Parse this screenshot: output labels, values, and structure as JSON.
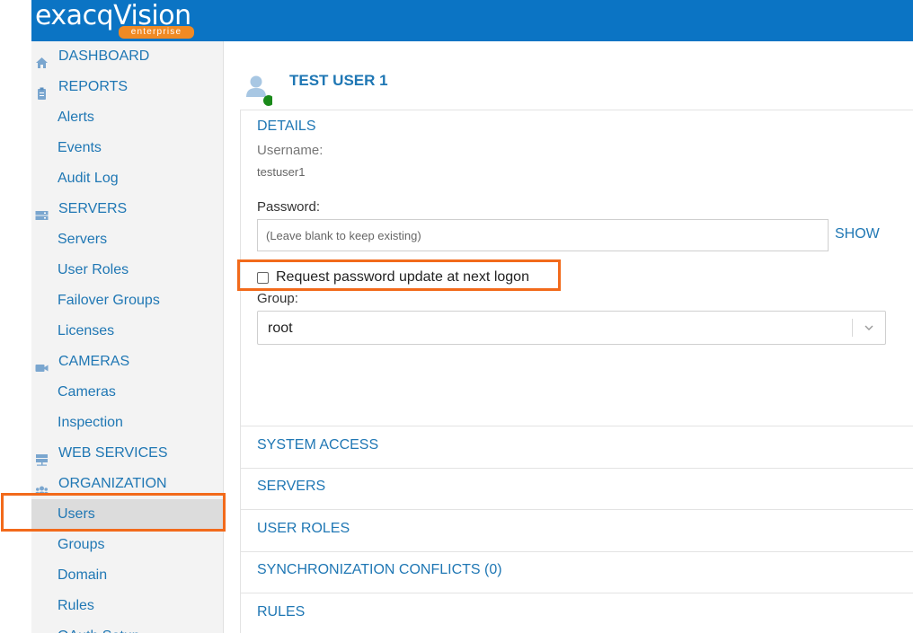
{
  "brand": {
    "logo_text": "exacqVision",
    "logo_sub": "enterprise",
    "header_color": "#0b74c4",
    "accent_color": "#f26a1b"
  },
  "sidebar": {
    "items": [
      {
        "label": "DASHBOARD",
        "kind": "top",
        "icon": "home-icon"
      },
      {
        "label": "REPORTS",
        "kind": "top",
        "icon": "clipboard-icon"
      },
      {
        "label": "Alerts",
        "kind": "sub"
      },
      {
        "label": "Events",
        "kind": "sub"
      },
      {
        "label": "Audit Log",
        "kind": "sub"
      },
      {
        "label": "SERVERS",
        "kind": "top",
        "icon": "server-icon"
      },
      {
        "label": "Servers",
        "kind": "sub"
      },
      {
        "label": "User Roles",
        "kind": "sub"
      },
      {
        "label": "Failover Groups",
        "kind": "sub"
      },
      {
        "label": "Licenses",
        "kind": "sub"
      },
      {
        "label": "CAMERAS",
        "kind": "top",
        "icon": "camera-icon"
      },
      {
        "label": "Cameras",
        "kind": "sub"
      },
      {
        "label": "Inspection",
        "kind": "sub"
      },
      {
        "label": "WEB SERVICES",
        "kind": "top",
        "icon": "network-icon"
      },
      {
        "label": "ORGANIZATION",
        "kind": "top",
        "icon": "group-icon"
      },
      {
        "label": "Users",
        "kind": "sub",
        "active": true
      },
      {
        "label": "Groups",
        "kind": "sub"
      },
      {
        "label": "Domain",
        "kind": "sub"
      },
      {
        "label": "Rules",
        "kind": "sub"
      },
      {
        "label": "OAuth Setup",
        "kind": "sub"
      }
    ]
  },
  "user": {
    "name": "TEST USER 1",
    "status_color": "#1a8a1a"
  },
  "details": {
    "heading": "DETAILS",
    "username_label": "Username:",
    "username_value": "testuser1",
    "password_label": "Password:",
    "password_placeholder": "(Leave blank to keep existing)",
    "show_label": "SHOW",
    "request_update_label": "Request password update at next logon",
    "request_update_checked": false,
    "group_label": "Group:",
    "group_value": "root"
  },
  "sections": [
    "SYSTEM ACCESS",
    "SERVERS",
    "USER ROLES",
    "SYNCHRONIZATION CONFLICTS (0)",
    "RULES"
  ]
}
